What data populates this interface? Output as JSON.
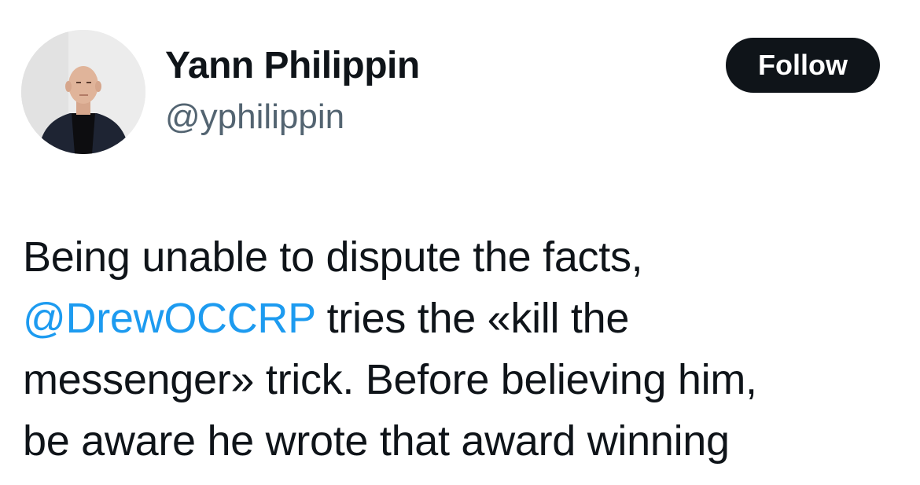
{
  "author": {
    "name": "Yann Philippin",
    "handle": "@yphilippin",
    "avatar_icon": "profile-photo"
  },
  "follow_button": {
    "label": "Follow"
  },
  "tweet": {
    "line1": "Being unable to dispute the facts,",
    "line2_mention": "@DrewOCCRP",
    "line2_rest": " tries the «kill the",
    "line3": "messenger» trick. Before believing him,",
    "line4": "be aware he wrote that award winning"
  },
  "colors": {
    "text": "#0f1419",
    "handle": "#536471",
    "link": "#1d9bf0",
    "button_bg": "#0f1419",
    "button_text": "#ffffff"
  }
}
